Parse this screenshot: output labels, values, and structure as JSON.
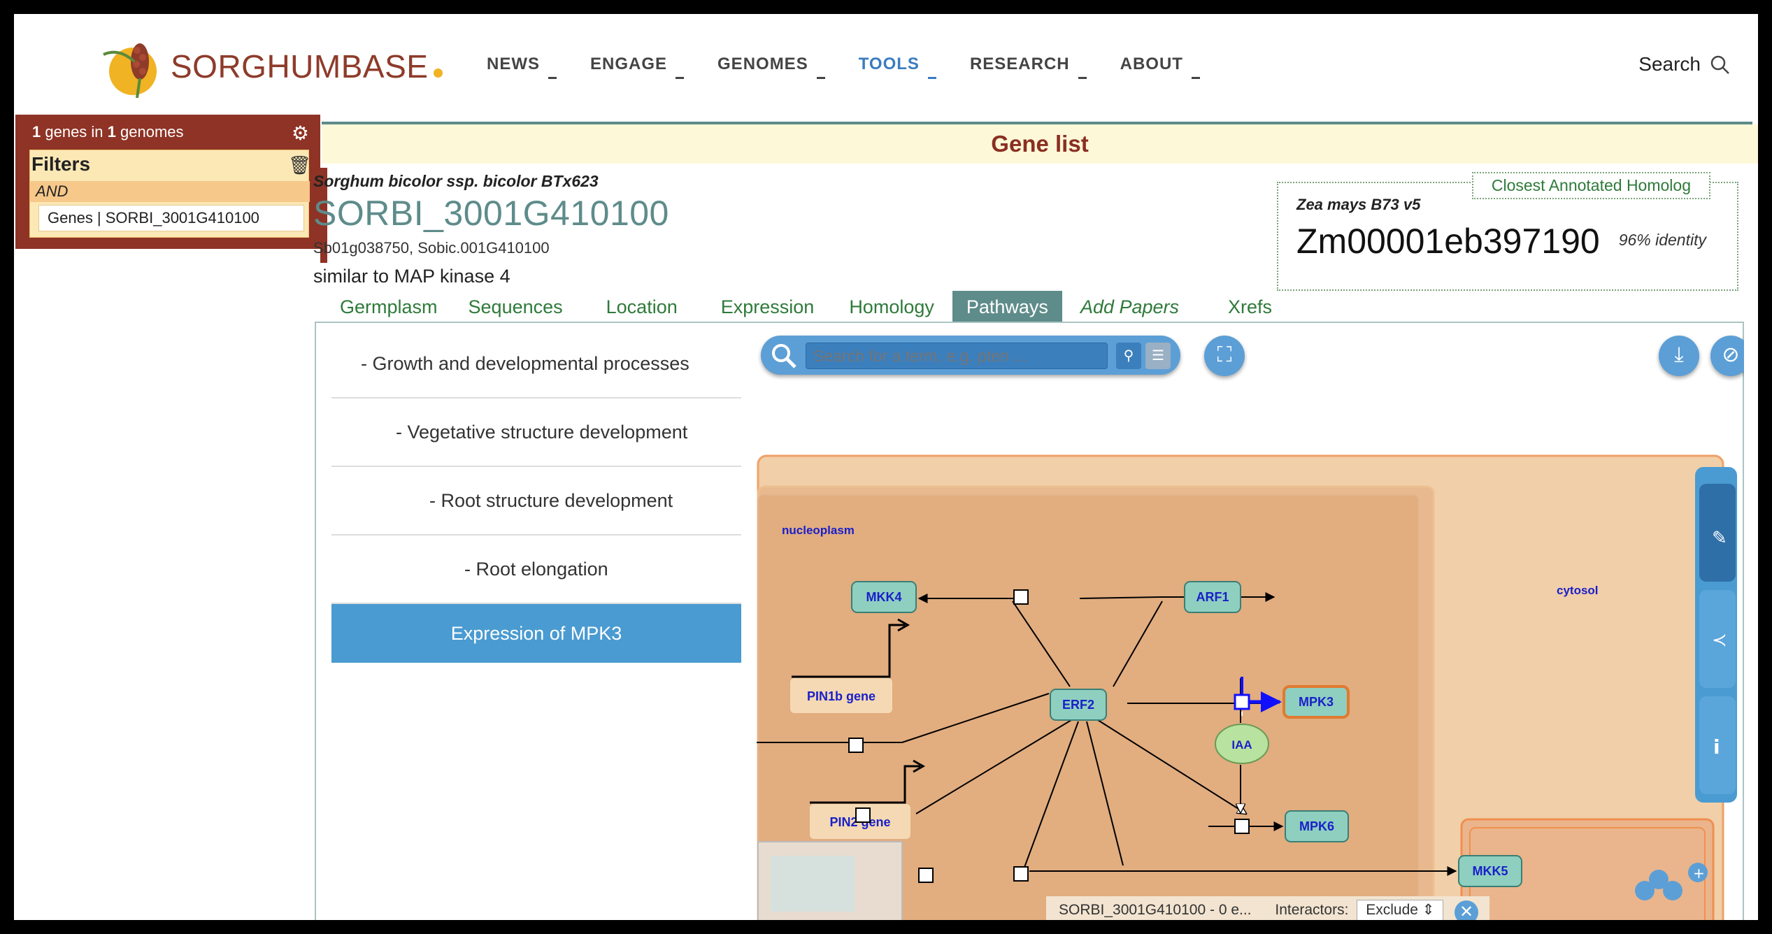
{
  "brand": {
    "name": "SORGHUMBASE",
    "accent": "#8e3b2a",
    "dot_color": "#f0b323"
  },
  "nav": {
    "items": [
      {
        "label": "NEWS"
      },
      {
        "label": "ENGAGE"
      },
      {
        "label": "GENOMES"
      },
      {
        "label": "TOOLS",
        "active": true
      },
      {
        "label": "RESEARCH"
      },
      {
        "label": "ABOUT"
      }
    ],
    "search_label": "Search"
  },
  "sidebar": {
    "genes_count": "1",
    "genes_label": " genes in ",
    "genomes_count": "1",
    "genomes_label": " genomes",
    "filters_title": "Filters",
    "operator": "AND",
    "filter_chip": "Genes | SORBI_3001G410100"
  },
  "gene_list_title": "Gene list",
  "gene": {
    "species": "Sorghum bicolor ssp. bicolor BTx623",
    "id": "SORBI_3001G410100",
    "synonyms": "Sb01g038750, Sobic.001G410100",
    "description": "similar to MAP kinase 4"
  },
  "homolog": {
    "tag": "Closest Annotated Homolog",
    "species": "Zea mays B73 v5",
    "id": "Zm00001eb397190",
    "identity": "96% identity"
  },
  "tabs": [
    {
      "label": "Germplasm"
    },
    {
      "label": "Sequences"
    },
    {
      "label": "Location"
    },
    {
      "label": "Expression"
    },
    {
      "label": "Homology"
    },
    {
      "label": "Pathways",
      "active": true
    },
    {
      "label": "Add Papers",
      "italic": true
    },
    {
      "label": "Xrefs"
    }
  ],
  "pathway_hierarchy": [
    {
      "label": "-  Growth and developmental processes"
    },
    {
      "label": "-  Vegetative structure development"
    },
    {
      "label": "-  Root structure development"
    },
    {
      "label": "-  Root elongation"
    },
    {
      "label": "Expression of MPK3",
      "selected": true
    }
  ],
  "reactome": {
    "search_placeholder": "Search for a term, e.g. pten ...",
    "compartments": {
      "nucleoplasm": "nucleoplasm",
      "cytosol": "cytosol"
    },
    "nodes": {
      "mkk4": "MKK4",
      "arf1": "ARF1",
      "erf2": "ERF2",
      "mpk3": "MPK3",
      "iaa": "IAA",
      "mpk6": "MPK6",
      "mkk5": "MKK5",
      "pin1b": "PIN1b gene",
      "pin2": "PIN2 gene"
    },
    "bottom_bar": {
      "gene": "SORBI_3001G410100 - 0 e...",
      "interactors_label": "Interactors:",
      "interactors_value": "Exclude"
    }
  }
}
